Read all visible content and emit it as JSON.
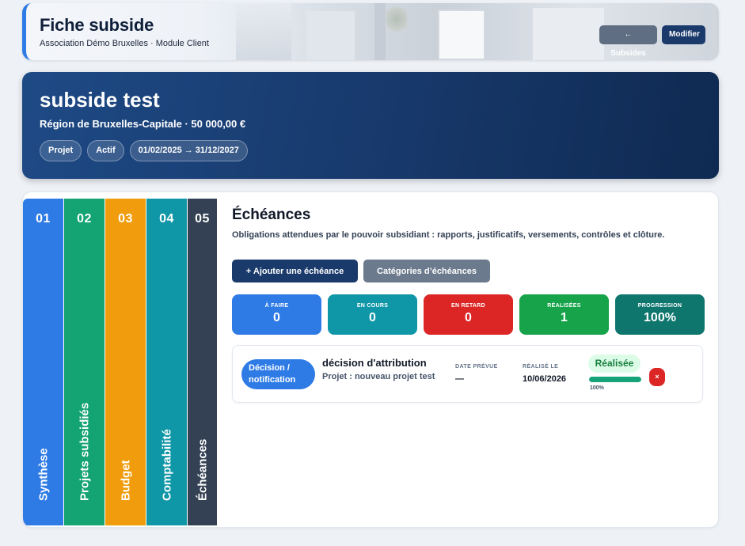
{
  "header": {
    "title": "Fiche subside",
    "subtitle": "Association Démo Bruxelles · Module Client",
    "back_label": "← Subsides",
    "edit_label": "Modifier"
  },
  "hero": {
    "title": "subside test",
    "subtitle": "Région de Bruxelles-Capitale · 50 000,00 €",
    "chips": [
      "Projet",
      "Actif",
      "01/02/2025 → 31/12/2027"
    ]
  },
  "tabs": [
    {
      "num": "01",
      "label": "Synthèse",
      "color": "#2f7be6"
    },
    {
      "num": "02",
      "label": "Projets subsidiés",
      "color": "#14a373"
    },
    {
      "num": "03",
      "label": "Budget",
      "color": "#f09c0c"
    },
    {
      "num": "04",
      "label": "Comptabilité",
      "color": "#0f97a7"
    },
    {
      "num": "05",
      "label": "Échéances",
      "color": "#344154",
      "active": true
    }
  ],
  "panel": {
    "title": "Échéances",
    "description": "Obligations attendues par le pouvoir subsidiant : rapports, justificatifs, versements, contrôles et clôture.",
    "add_label": "+ Ajouter une échéance",
    "categories_label": "Catégories d’échéances"
  },
  "stats": [
    {
      "label": "À FAIRE",
      "value": "0",
      "color": "#2f7be6"
    },
    {
      "label": "EN COURS",
      "value": "0",
      "color": "#0f97a7"
    },
    {
      "label": "EN RETARD",
      "value": "0",
      "color": "#dc2626"
    },
    {
      "label": "RÉALISÉES",
      "value": "1",
      "color": "#16a34a"
    },
    {
      "label": "PROGRESSION",
      "value": "100%",
      "color": "#0f766e"
    }
  ],
  "deadline": {
    "type": "Décision / notification",
    "title": "décision d'attribution",
    "project": "Projet : nouveau projet test",
    "expected_label": "DATE PRÉVUE",
    "expected_value": "—",
    "done_label": "RÉALISÉ LE",
    "done_value": "10/06/2026",
    "status": "Réalisée",
    "progress": 1.0,
    "progress_label": "100%",
    "delete_icon": "×"
  }
}
